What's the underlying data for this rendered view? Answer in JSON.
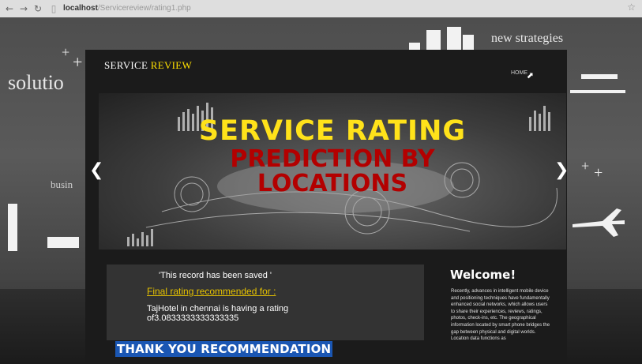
{
  "browser": {
    "back_icon": "arrow-left-icon",
    "forward_icon": "arrow-right-icon",
    "reload_icon": "reload-icon",
    "url_host": "localhost",
    "url_path": "/Servicereview/rating1.php"
  },
  "background": {
    "words": [
      "solutio",
      "new strategies",
      "busin"
    ]
  },
  "header": {
    "brand_prefix": "SERVICE ",
    "brand_highlight": "REVIEW",
    "home_label": "HOME"
  },
  "banner": {
    "line1": "SERVICE RATING",
    "line2": "PREDICTION BY",
    "line3": "LOCATIONS",
    "prev_icon": "chevron-left-icon",
    "next_icon": "chevron-right-icon"
  },
  "result": {
    "saved_message": "'This record has been saved '",
    "final_label": "Final rating recommended for :",
    "detail": "TajHotel in chennai is having a rating of3.0833333333333335",
    "thank_you": "THANK YOU RECOMMENDATION"
  },
  "welcome": {
    "title": "Welcome!",
    "text": "Recently, advances in intelligent mobile device and positioning techniques have fundamentally enhanced social networks, which allows users to share their experiences, reviews, ratings, photos, check-ins, etc. The geographical information located by smart phone bridges the gap between physical and digital worlds. Location data functions as"
  },
  "colors": {
    "brand_highlight": "#ffe000",
    "banner_yellow": "#ffe21a",
    "banner_red": "#b30000",
    "final_label": "#e6c200",
    "thank_you_bg": "#1a56b3"
  }
}
